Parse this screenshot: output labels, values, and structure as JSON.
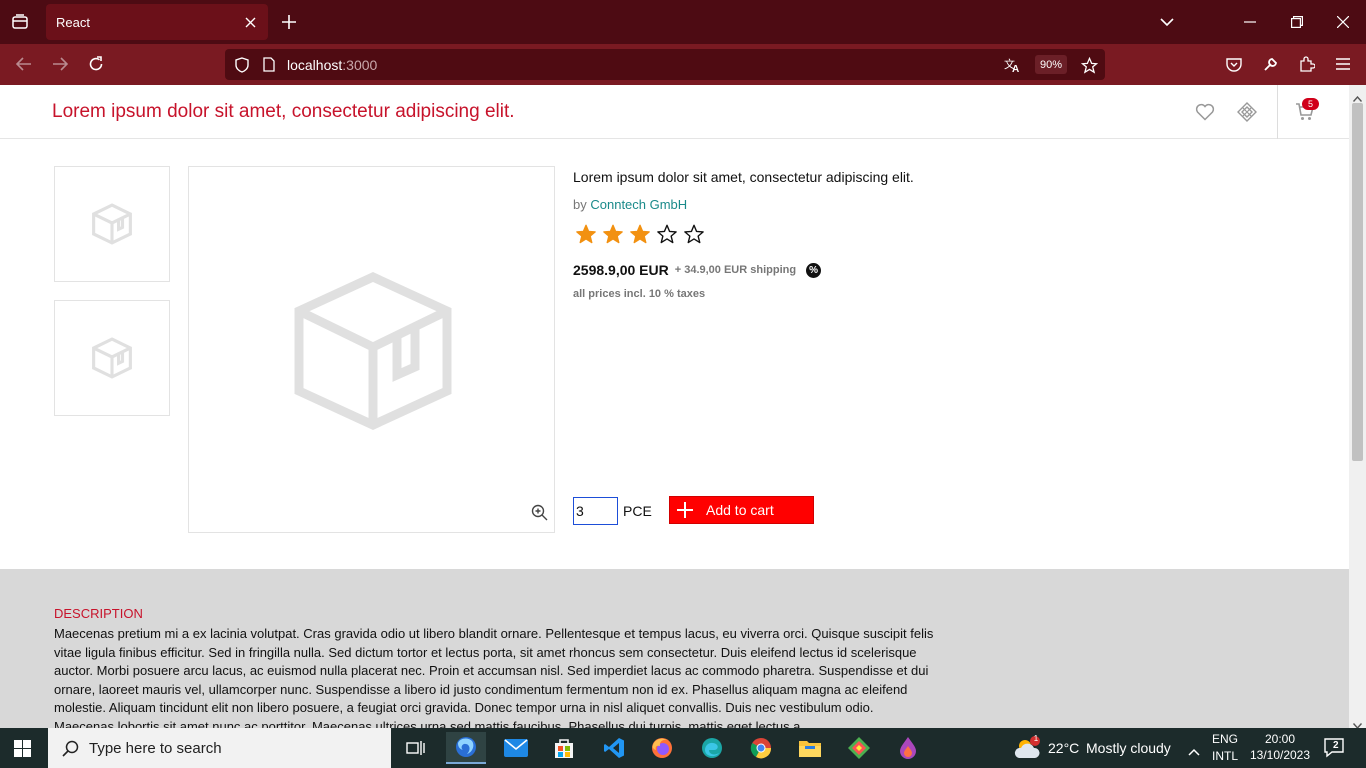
{
  "browser": {
    "tab_title": "React",
    "url_host": "localhost",
    "url_port": ":3000",
    "zoom": "90%"
  },
  "header": {
    "title": "Lorem ipsum dolor sit amet, consectetur adipiscing elit.",
    "cart_count": "5"
  },
  "product": {
    "title": "Lorem ipsum dolor sit amet, consectetur adipiscing elit.",
    "by_prefix": "by",
    "brand": "Conntech GmbH",
    "rating": 3,
    "rating_max": 5,
    "price": "2598.9,00 EUR",
    "shipping": "+ 34.9,00 EUR shipping",
    "discount_icon": "%",
    "tax_note": "all prices incl. 10 % taxes",
    "quantity": "3",
    "unit": "PCE",
    "add_to_cart_label": "Add to cart"
  },
  "description": {
    "heading": "DESCRIPTION",
    "text": "Maecenas pretium mi a ex lacinia volutpat. Cras gravida odio ut libero blandit ornare. Pellentesque et tempus lacus, eu viverra orci. Quisque suscipit felis vitae ligula finibus efficitur. Sed in fringilla nulla. Sed dictum tortor et lectus porta, sit amet rhoncus sem consectetur. Duis eleifend lectus id scelerisque auctor. Morbi posuere arcu lacus, ac euismod nulla placerat nec. Proin et accumsan nisl. Sed imperdiet lacus ac commodo pharetra. Suspendisse et dui ornare, laoreet mauris vel, ullamcorper nunc. Suspendisse a libero id justo condimentum fermentum non id ex. Phasellus aliquam magna ac eleifend molestie. Aliquam tincidunt elit non libero posuere, a feugiat orci gravida. Donec tempor urna in nisl aliquet convallis. Duis nec vestibulum odio. Maecenas lobortis sit amet nunc ac porttitor. Maecenas ultrices urna sed mattis faucibus. Phasellus dui turpis, mattis eget lectus a"
  },
  "taskbar": {
    "search_placeholder": "Type here to search",
    "weather_temp": "22°C",
    "weather_text": "Mostly cloudy",
    "weather_alert": "1",
    "lang_line1": "ENG",
    "lang_line2": "INTL",
    "time": "20:00",
    "date": "13/10/2023",
    "notification_count": "2"
  },
  "colors": {
    "accent": "#c7132b",
    "add_to_cart": "#ff0000",
    "star_filled": "#f29111",
    "brand_link": "#1a8a8a",
    "chrome_dark": "#4d0b13",
    "chrome_nav": "#7a1a22"
  }
}
